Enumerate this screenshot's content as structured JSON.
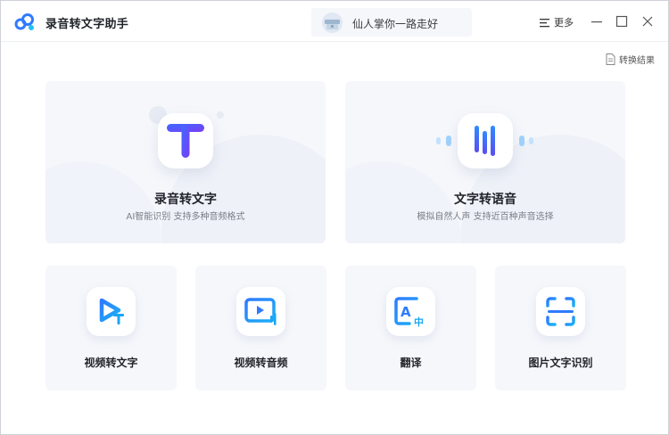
{
  "app": {
    "title": "录音转文字助手"
  },
  "user": {
    "name": "仙人掌你一路走好"
  },
  "header": {
    "more_label": "更多"
  },
  "toolbar": {
    "result_label": "转换结果"
  },
  "features_main": [
    {
      "title": "录音转文字",
      "subtitle": "AI智能识别 支持多种音频格式",
      "icon": "text-t-icon"
    },
    {
      "title": "文字转语音",
      "subtitle": "模拟自然人声 支持近百种声音选择",
      "icon": "sound-wave-icon"
    }
  ],
  "features_small": [
    {
      "title": "视频转文字",
      "icon": "video-to-text-icon"
    },
    {
      "title": "视频转音频",
      "icon": "video-to-audio-icon"
    },
    {
      "title": "翻译",
      "icon": "translate-icon"
    },
    {
      "title": "图片文字识别",
      "icon": "scan-icon"
    }
  ],
  "colors": {
    "accent": "#2f6bff",
    "accent2": "#1aa5f5",
    "card_bg": "#f5f7fb"
  }
}
